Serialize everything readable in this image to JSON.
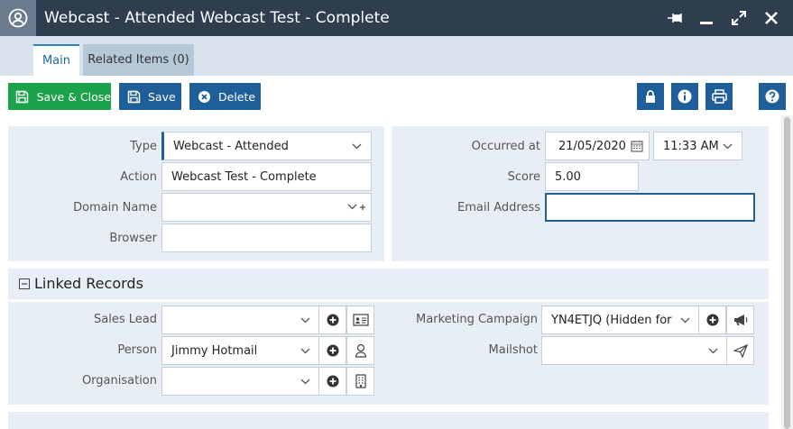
{
  "window": {
    "title": "Webcast - Attended Webcast Test - Complete"
  },
  "tabs": [
    {
      "label": "Main"
    },
    {
      "label": "Related Items (0)"
    }
  ],
  "toolbar": {
    "save_close_label": "Save & Close",
    "save_label": "Save",
    "delete_label": "Delete"
  },
  "details": {
    "type": {
      "label": "Type",
      "value": "Webcast - Attended"
    },
    "action": {
      "label": "Action",
      "value": "Webcast Test - Complete"
    },
    "domain_name": {
      "label": "Domain Name",
      "value": ""
    },
    "browser": {
      "label": "Browser",
      "value": ""
    },
    "occurred_at": {
      "label": "Occurred at",
      "date": "21/05/2020",
      "time": "11:33 AM"
    },
    "score": {
      "label": "Score",
      "value": "5.00"
    },
    "email_address": {
      "label": "Email Address",
      "value": ""
    }
  },
  "linked_records": {
    "title": "Linked Records",
    "sales_lead": {
      "label": "Sales Lead",
      "value": ""
    },
    "person": {
      "label": "Person",
      "value": "Jimmy Hotmail"
    },
    "organisation": {
      "label": "Organisation",
      "value": ""
    },
    "marketing_campaign": {
      "label": "Marketing Campaign",
      "value": "YN4ETJQ (Hidden for I"
    },
    "mailshot": {
      "label": "Mailshot",
      "value": ""
    }
  },
  "icons": {
    "user": "user-icon",
    "pin": "pin-icon",
    "minimize": "minimize-icon",
    "maximize": "maximize-icon",
    "close": "close-icon",
    "lock": "lock-icon",
    "info": "info-icon",
    "print": "print-icon",
    "help": "help-icon"
  },
  "colors": {
    "titlebar": "#2f3e4f",
    "save_close": "#1aa34a",
    "primary": "#1f5f99",
    "panel": "#e7eef5",
    "tabstrip": "#d8e3ed"
  }
}
